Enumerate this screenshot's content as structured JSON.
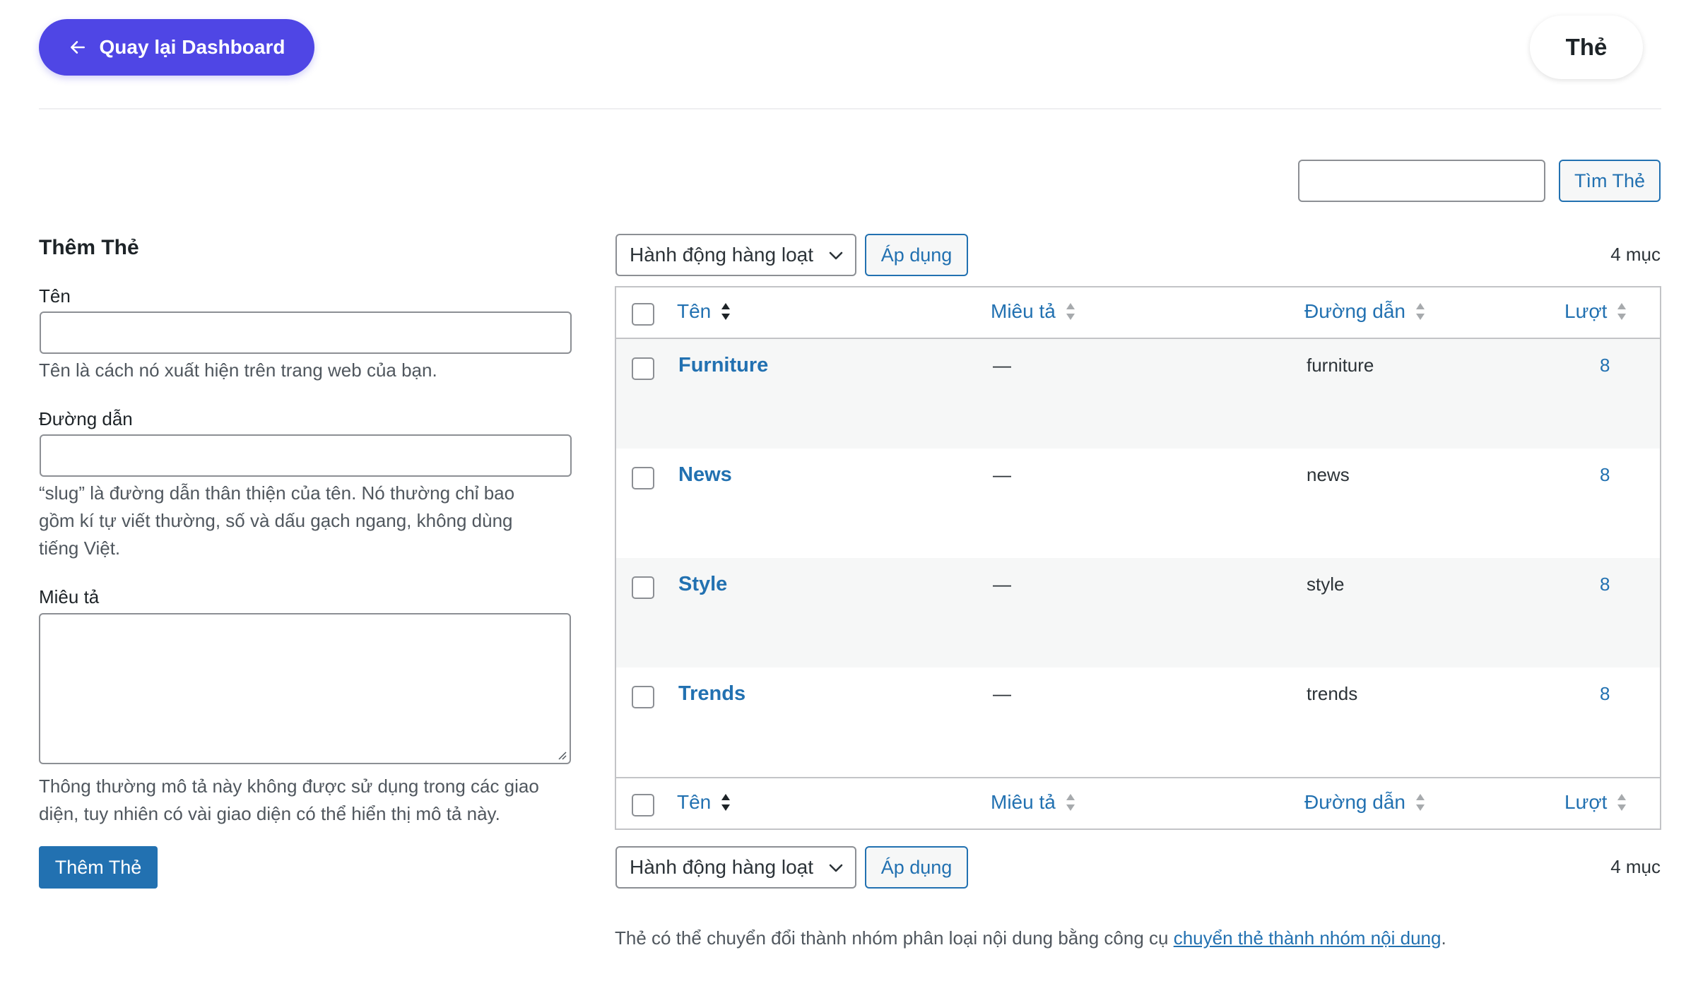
{
  "header": {
    "back_label": "Quay lại Dashboard",
    "page_title": "Thẻ"
  },
  "search": {
    "value": "",
    "button_label": "Tìm Thẻ"
  },
  "form": {
    "title": "Thêm Thẻ",
    "name_label": "Tên",
    "name_hint": "Tên là cách nó xuất hiện trên trang web của bạn.",
    "slug_label": "Đường dẫn",
    "slug_hint_lines": [
      "“slug” là đường dẫn thân thiện của tên. Nó thường chỉ bao",
      "gồm kí tự viết thường, số và dấu gạch ngang, không dùng",
      "tiếng Việt."
    ],
    "desc_label": "Miêu tả",
    "desc_hint_lines": [
      "Thông thường mô tả này không được sử dụng trong các giao",
      "diện, tuy nhiên có vài giao diện có thể hiển thị mô tả này."
    ],
    "submit_label": "Thêm Thẻ"
  },
  "bulk": {
    "select_label": "Hành động hàng loạt",
    "apply_label": "Áp dụng",
    "count_label": "4 mục"
  },
  "table": {
    "columns": [
      "Tên",
      "Miêu tả",
      "Đường dẫn",
      "Lượt"
    ],
    "rows": [
      {
        "name": "Furniture",
        "description": "—",
        "slug": "furniture",
        "count": "8"
      },
      {
        "name": "News",
        "description": "—",
        "slug": "news",
        "count": "8"
      },
      {
        "name": "Style",
        "description": "—",
        "slug": "style",
        "count": "8"
      },
      {
        "name": "Trends",
        "description": "—",
        "slug": "trends",
        "count": "8"
      }
    ]
  },
  "footnote": {
    "text": "Thẻ có thể chuyển đổi thành nhóm phân loại nội dung bằng công cụ ",
    "link": "chuyển thẻ thành nhóm nội dung",
    "suffix": "."
  },
  "colors": {
    "accent": "#4f46e5",
    "wp_blue": "#2271b1",
    "row_alt": "#f6f7f7",
    "border": "#c3c4c7"
  }
}
